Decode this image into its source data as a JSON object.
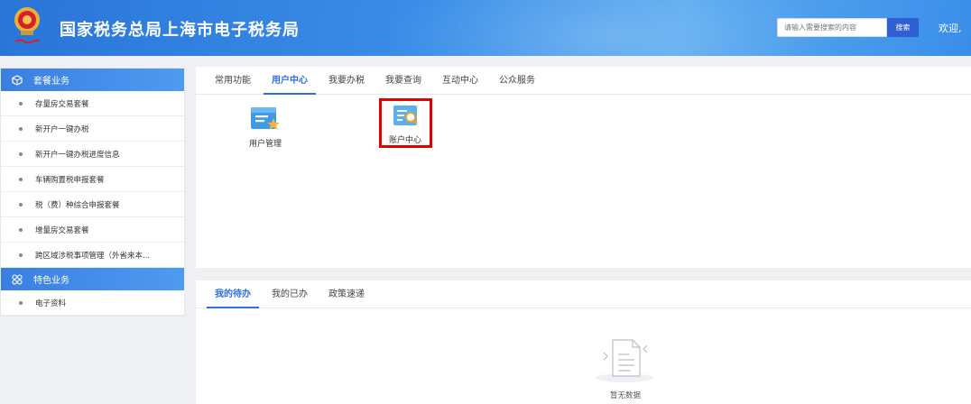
{
  "header": {
    "title": "国家税务总局上海市电子税务局",
    "search_placeholder": "请输入需要搜索的内容",
    "search_button": "搜索",
    "welcome": "欢迎,",
    "emblem_icon": "tax-emblem-icon"
  },
  "sidebar": {
    "groups": [
      {
        "title": "套餐业务",
        "icon": "cube-icon",
        "items": [
          {
            "label": "存量房交易套餐"
          },
          {
            "label": "新开户一键办税"
          },
          {
            "label": "新开户一键办税进度信息"
          },
          {
            "label": "车辆购置税申报套餐"
          },
          {
            "label": "税（费）种综合申报套餐"
          },
          {
            "label": "增量房交易套餐"
          },
          {
            "label": "跨区域涉税事项管理（外省来本..."
          }
        ]
      },
      {
        "title": "特色业务",
        "icon": "grid-circles-icon",
        "items": [
          {
            "label": "电子资料"
          }
        ]
      }
    ]
  },
  "main_tabs": [
    {
      "label": "常用功能"
    },
    {
      "label": "用户中心",
      "active": true
    },
    {
      "label": "我要办税"
    },
    {
      "label": "我要查询"
    },
    {
      "label": "互动中心"
    },
    {
      "label": "公众服务"
    }
  ],
  "functions": [
    {
      "label": "用户管理",
      "icon": "user-management-icon"
    },
    {
      "label": "账户中心",
      "icon": "account-center-icon",
      "highlighted": true
    }
  ],
  "todo_tabs": [
    {
      "label": "我的待办",
      "active": true
    },
    {
      "label": "我的已办"
    },
    {
      "label": "政策速递"
    }
  ],
  "empty_state": {
    "text": "暂无数据",
    "icon": "empty-document-icon"
  },
  "colors": {
    "accent": "#2f6fe0",
    "highlight": "#e30000",
    "header": "#3a8ee8"
  }
}
